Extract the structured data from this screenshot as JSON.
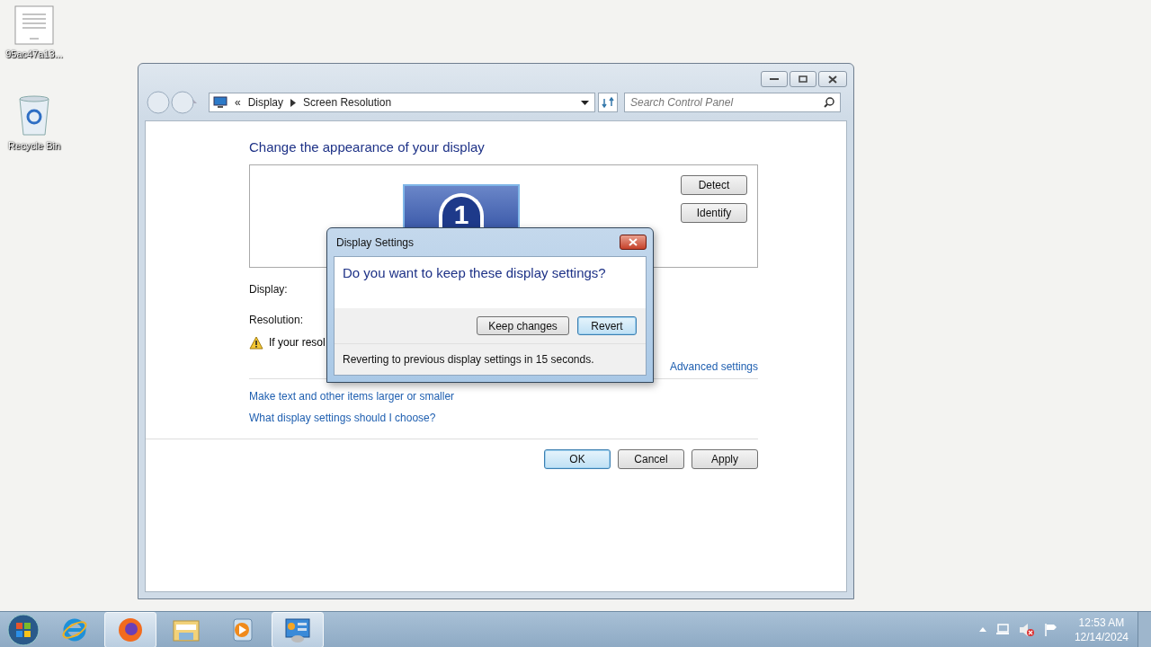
{
  "desktop_icons": [
    {
      "kind": "document",
      "label": "95ac47a13..."
    },
    {
      "kind": "recycle",
      "label": "Recycle Bin"
    }
  ],
  "window": {
    "breadcrumb": [
      "Display",
      "Screen Resolution"
    ],
    "breadcrumb_chevron": "«",
    "search": {
      "placeholder": "Search Control Panel"
    },
    "heading": "Change the appearance of your display",
    "monitor_number": "1",
    "side_buttons": [
      "Detect",
      "Identify"
    ],
    "display_label": "Display:",
    "resolution_label": "Resolution:",
    "warning": "If your resol",
    "advanced_link": "Advanced settings",
    "links": [
      "Make text and other items larger or smaller",
      "What display settings should I choose?"
    ],
    "buttons": [
      {
        "label": "OK",
        "selected": true
      },
      {
        "label": "Cancel",
        "selected": false
      },
      {
        "label": "Apply",
        "selected": false
      }
    ]
  },
  "dialog": {
    "title": "Display Settings",
    "question": "Do you want to keep these display settings?",
    "buttons": [
      {
        "label": "Keep changes",
        "selected": false
      },
      {
        "label": "Revert",
        "selected": true
      }
    ],
    "footer": "Reverting to previous display settings in 15 seconds."
  },
  "taskbar": {
    "items": [
      {
        "kind": "ie",
        "selected": false
      },
      {
        "kind": "firefox",
        "selected": true
      },
      {
        "kind": "folder",
        "selected": false
      },
      {
        "kind": "media",
        "selected": false
      },
      {
        "kind": "control-panel",
        "selected": true
      }
    ],
    "time": "12:53 AM",
    "date": "12/14/2024"
  }
}
